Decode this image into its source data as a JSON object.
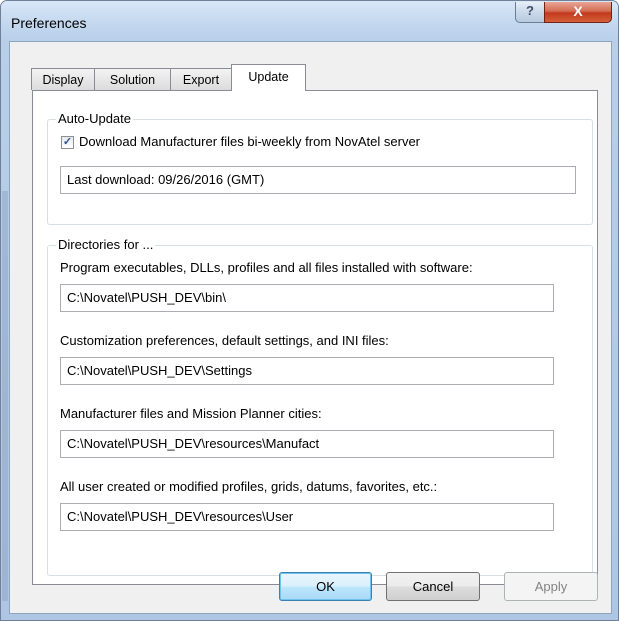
{
  "window": {
    "title": "Preferences",
    "help_glyph": "?",
    "close_glyph": "X"
  },
  "tabs": [
    {
      "label": "Display",
      "active": false
    },
    {
      "label": "Solution",
      "active": false
    },
    {
      "label": "Export",
      "active": false
    },
    {
      "label": "Update",
      "active": true
    }
  ],
  "auto_update": {
    "legend": "Auto-Update",
    "checkbox_label": "Download Manufacturer files bi-weekly from NovAtel server",
    "checked": true,
    "last_download": "Last download: 09/26/2016 (GMT)"
  },
  "directories": {
    "legend": "Directories for ...",
    "entries": [
      {
        "label": "Program executables, DLLs, profiles and all files installed with software:",
        "value": "C:\\Novatel\\PUSH_DEV\\bin\\"
      },
      {
        "label": "Customization preferences, default settings, and INI files:",
        "value": "C:\\Novatel\\PUSH_DEV\\Settings"
      },
      {
        "label": "Manufacturer files and Mission Planner cities:",
        "value": "C:\\Novatel\\PUSH_DEV\\resources\\Manufact"
      },
      {
        "label": "All user created or modified profiles, grids, datums, favorites, etc.:",
        "value": "C:\\Novatel\\PUSH_DEV\\resources\\User"
      }
    ]
  },
  "buttons": {
    "ok": "OK",
    "cancel": "Cancel",
    "apply": "Apply",
    "apply_enabled": false
  },
  "colors": {
    "frame": "#b9cfea",
    "close": "#c2391d",
    "default_button_border": "#3c7fb1"
  }
}
